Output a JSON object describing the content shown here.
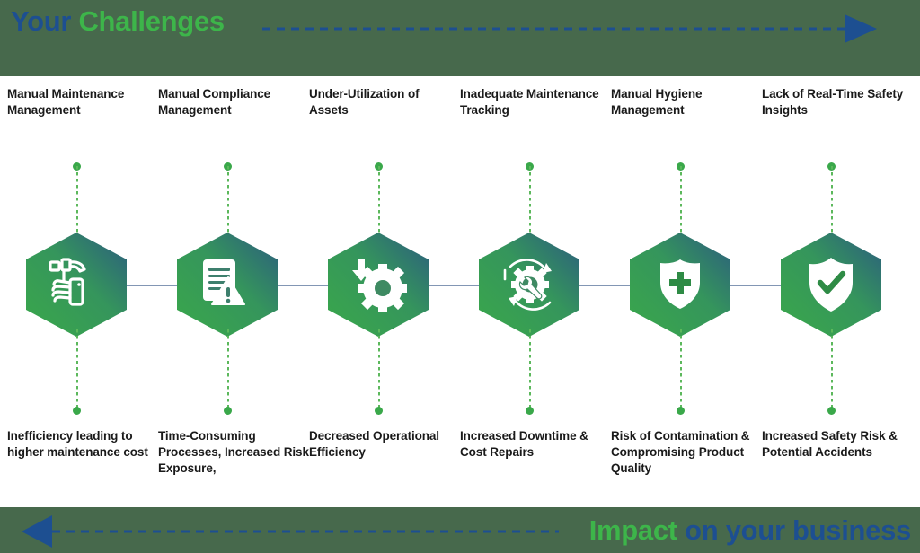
{
  "header": {
    "title_part1": "Your ",
    "title_part2": "Challenges",
    "arrow_icon": "arrow-right-dashed-icon",
    "bg_color": "#47694c",
    "blue": "#1d4f91",
    "green": "#3db54a"
  },
  "footer": {
    "title_part1": "Impact",
    "title_part2": " on your business",
    "arrow_icon": "arrow-left-dashed-icon",
    "bg_color": "#47694c"
  },
  "theme": {
    "hex_gradient_from": "#3aa84a",
    "hex_gradient_to": "#2b5b80",
    "spine_color": "#8296b4",
    "dotted_color": "#5cb85c",
    "label_color": "#1a1a1a"
  },
  "columns": [
    {
      "top_label": "Manual Maintenance Management",
      "bottom_label": "Inefficiency leading to higher maintenance cost",
      "icon": "hammer-in-hand-icon"
    },
    {
      "top_label": "Manual Compliance Management",
      "bottom_label": "Time-Consuming Processes, Increased Risk Exposure,",
      "icon": "document-warning-icon"
    },
    {
      "top_label": "Under-Utilization of Assets",
      "bottom_label": "Decreased Operational Efficiency",
      "icon": "gear-down-arrow-icon"
    },
    {
      "top_label": "Inadequate Maintenance Tracking",
      "bottom_label": "Increased Downtime & Cost Repairs",
      "icon": "gear-wrench-refresh-icon"
    },
    {
      "top_label": "Manual Hygiene Management",
      "bottom_label": "Risk of Contamination & Compromising Product Quality",
      "icon": "shield-medical-cross-icon"
    },
    {
      "top_label": "Lack of Real-Time Safety Insights",
      "bottom_label": "Increased Safety Risk & Potential Accidents",
      "icon": "shield-check-icon"
    }
  ]
}
